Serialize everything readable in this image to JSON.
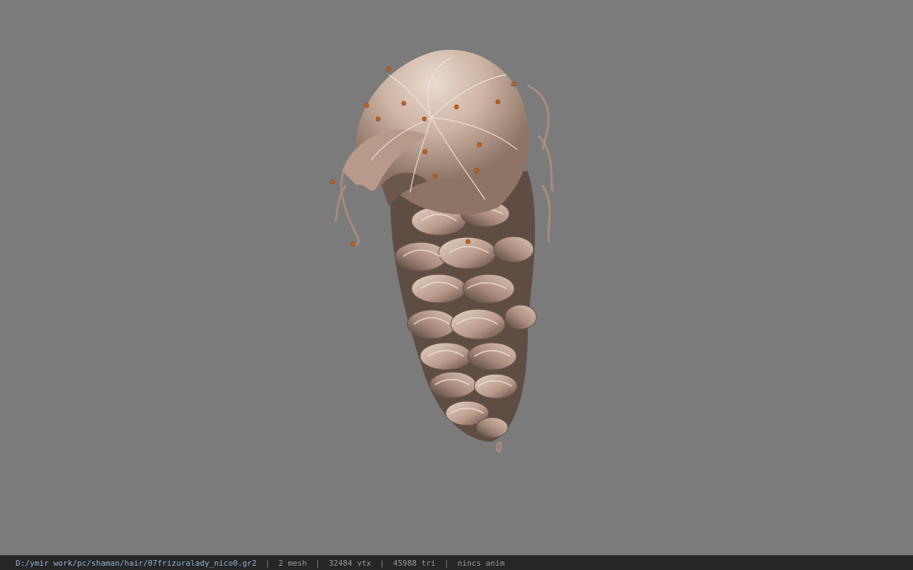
{
  "viewport": {
    "background": "#7b7b7b",
    "model": {
      "description_icon": "hair-model-icon",
      "hair_color": "#c9b3a3",
      "marker_color": "#c0621f"
    }
  },
  "statusbar": {
    "path": "D:/ymir work/pc/shaman/hair/07frizuralady_nico0.gr2",
    "mesh": "2 mesh",
    "vtx": "32484 vtx",
    "tri": "45988 tri",
    "anim": "nincs anim",
    "separator": "|"
  }
}
